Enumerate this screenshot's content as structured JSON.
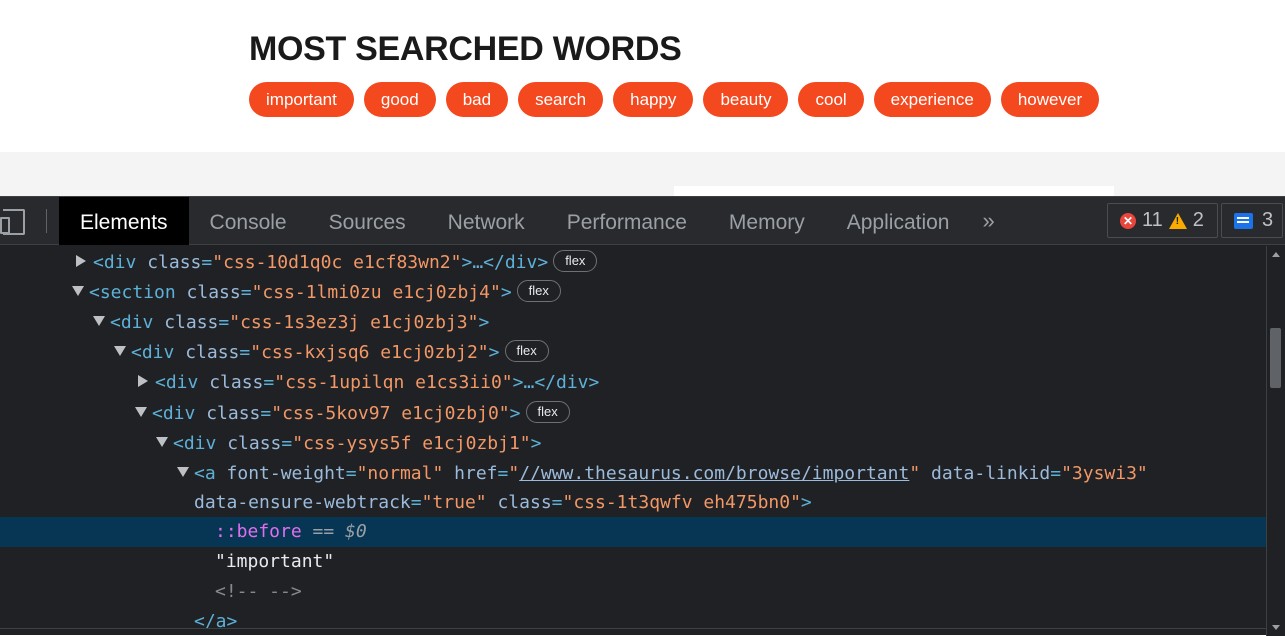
{
  "page": {
    "title": "MOST SEARCHED WORDS",
    "pill_color": "#f4481e",
    "words": [
      "important",
      "good",
      "bad",
      "search",
      "happy",
      "beauty",
      "cool",
      "experience",
      "however"
    ]
  },
  "devtools": {
    "tabs": [
      "Elements",
      "Console",
      "Sources",
      "Network",
      "Performance",
      "Memory",
      "Application"
    ],
    "active_tab": "Elements",
    "more_tabs": "»",
    "error_count": "11",
    "warning_count": "2",
    "message_count": "3",
    "tree": {
      "l0": {
        "tag_open": "<div",
        "attr": "class",
        "value": "\"css-10d1q0c e1cf83wn2\"",
        "tail": ">…</div>",
        "badge": "flex"
      },
      "l1": {
        "tag_open": "<section",
        "attr": "class",
        "value": "\"css-1lmi0zu e1cj0zbj4\"",
        "tail": ">",
        "badge": "flex"
      },
      "l2": {
        "tag_open": "<div",
        "attr": "class",
        "value": "\"css-1s3ez3j e1cj0zbj3\"",
        "tail": ">"
      },
      "l3": {
        "tag_open": "<div",
        "attr": "class",
        "value": "\"css-kxjsq6 e1cj0zbj2\"",
        "tail": ">",
        "badge": "flex"
      },
      "l4": {
        "tag_open": "<div",
        "attr": "class",
        "value": "\"css-1upilqn e1cs3ii0\"",
        "tail": ">…</div>"
      },
      "l5": {
        "tag_open": "<div",
        "attr": "class",
        "value": "\"css-5kov97 e1cj0zbj0\"",
        "tail": ">",
        "badge": "flex"
      },
      "l6": {
        "tag_open": "<div",
        "attr": "class",
        "value": "\"css-ysys5f e1cj0zbj1\"",
        "tail": ">"
      },
      "l7": {
        "tag_open": "<a",
        "attr1": "font-weight",
        "value1": "\"normal\"",
        "attr2": "href",
        "value2_q": "\"",
        "href": "//www.thesaurus.com/browse/important",
        "attr3": "data-linkid",
        "value3": "\"3yswi3\""
      },
      "l8": {
        "attr4": "data-ensure-webtrack",
        "value4": "\"true\"",
        "attr5": "class",
        "value5": "\"css-1t3qwfv eh475bn0\"",
        "tail": ">"
      },
      "l9": {
        "pseudo": "::before",
        "eq": "== $0"
      },
      "l10": {
        "text": "\"important\""
      },
      "l11": {
        "comment": "<!-- -->"
      },
      "l12": {
        "close": "</a>"
      }
    }
  }
}
